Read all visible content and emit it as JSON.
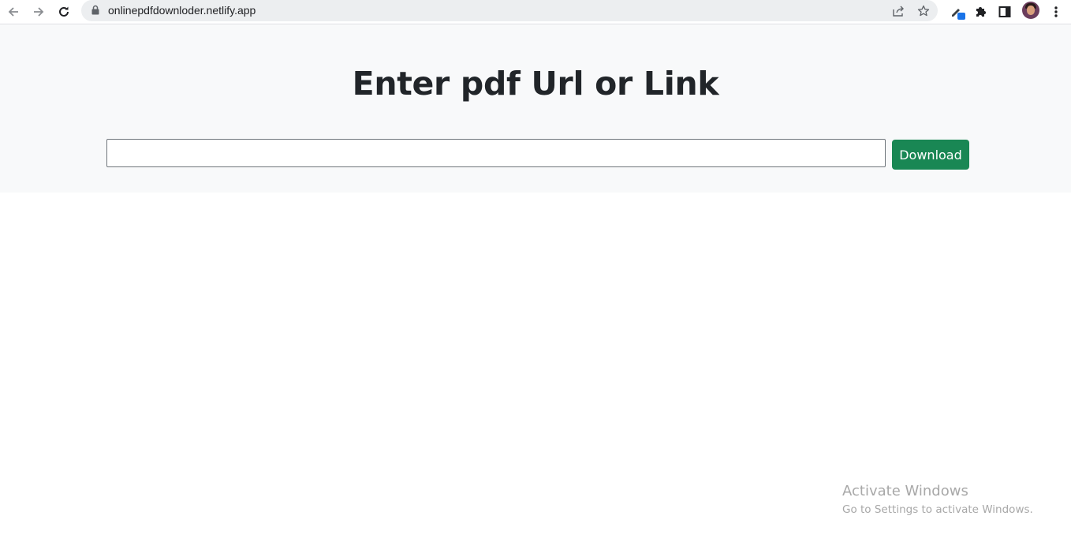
{
  "browser": {
    "url": "onlinepdfdownloder.netlify.app",
    "icons": [
      "back-arrow-icon",
      "forward-arrow-icon",
      "reload-icon",
      "lock-icon",
      "share-icon",
      "bookmark-star-icon",
      "extension-pen-icon",
      "puzzle-extensions-icon",
      "side-panel-icon",
      "profile-avatar",
      "more-menu-icon"
    ]
  },
  "page": {
    "heading": "Enter pdf Url or Link",
    "input_value": "",
    "input_placeholder": "",
    "download_label": "Download",
    "button_color": "#198754",
    "background_color": "#f8f9fa"
  },
  "watermark": {
    "title": "Activate Windows",
    "subtitle": "Go to Settings to activate Windows."
  }
}
